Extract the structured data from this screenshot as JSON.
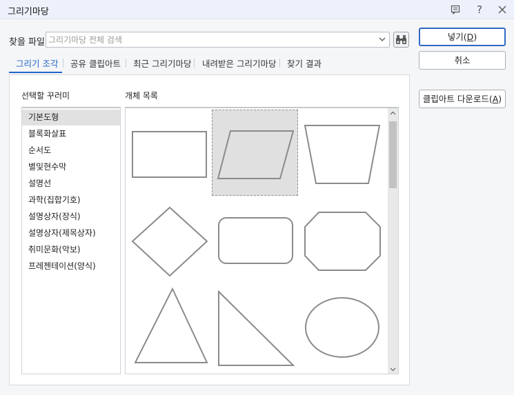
{
  "window": {
    "title": "그리기마당",
    "help_label": "?"
  },
  "search": {
    "label": "찾을 파일",
    "placeholder": "그리기마당 전체 검색",
    "value": ""
  },
  "tabs": [
    {
      "label": "그리기 조각",
      "active": true
    },
    {
      "label": "공유 클립아트",
      "active": false
    },
    {
      "label": "최근 그리기마당",
      "active": false
    },
    {
      "label": "내려받은 그리기마당",
      "active": false
    },
    {
      "label": "찾기 결과",
      "active": false
    }
  ],
  "panel": {
    "category_heading": "선택할 꾸러미",
    "objects_heading": "개체 목록",
    "categories": [
      "기본도형",
      "블록화살표",
      "순서도",
      "별및현수막",
      "설명선",
      "과학(집합기호)",
      "설명상자(장식)",
      "설명상자(제목상자)",
      "취미문화(악보)",
      "프레젠테이션(양식)"
    ],
    "selected_category_index": 0,
    "shapes": [
      {
        "icon": "rectangle-shape-icon",
        "selected": false
      },
      {
        "icon": "parallelogram-shape-icon",
        "selected": true
      },
      {
        "icon": "trapezoid-shape-icon",
        "selected": false
      },
      {
        "icon": "diamond-shape-icon",
        "selected": false
      },
      {
        "icon": "rounded-rectangle-shape-icon",
        "selected": false
      },
      {
        "icon": "octagon-shape-icon",
        "selected": false
      },
      {
        "icon": "isosceles-triangle-shape-icon",
        "selected": false
      },
      {
        "icon": "right-triangle-shape-icon",
        "selected": false
      },
      {
        "icon": "ellipse-shape-icon",
        "selected": false
      }
    ]
  },
  "buttons": {
    "insert": {
      "text": "넣기(",
      "key": "D",
      "close": ")"
    },
    "cancel": {
      "label": "취소"
    },
    "download": {
      "text": "클립아트 다운로드(",
      "key": "A",
      "close": ")"
    }
  },
  "colors": {
    "accent": "#1f64c8",
    "selected_bg": "#e0e0e0",
    "shape_stroke": "#8a8a8a"
  }
}
